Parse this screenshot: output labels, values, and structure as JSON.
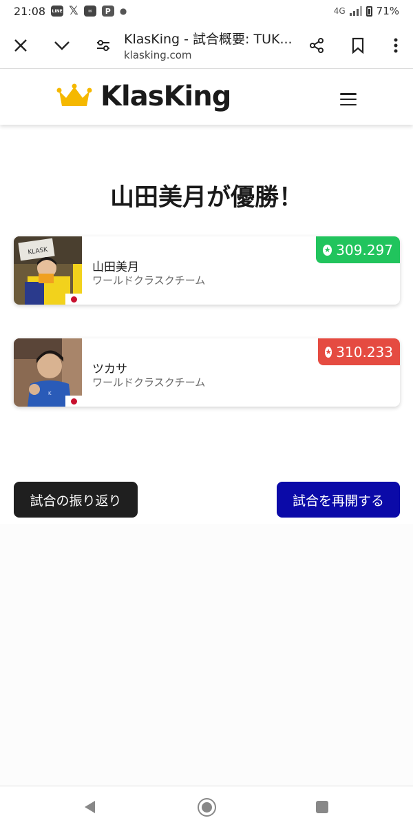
{
  "status_bar": {
    "time": "21:08",
    "app_icons": [
      "LINE",
      "X",
      "mail",
      "PayPay"
    ],
    "network": "4G",
    "battery": "71%"
  },
  "browser": {
    "page_title": "KlasKing - 試合概要: TUK...",
    "domain": "klasking.com",
    "icons": [
      "close-icon",
      "chevron-down-icon",
      "site-settings-icon",
      "share-icon",
      "bookmark-icon",
      "more-vert-icon"
    ]
  },
  "site": {
    "logo_text": "KlasKing",
    "colors": {
      "crown": "#f5b800"
    }
  },
  "match": {
    "headline": "山田美月が優勝！",
    "players": [
      {
        "name": "山田美月",
        "team": "ワールドクラスクチーム",
        "score": "309.297",
        "badge_color": "#21c45d"
      },
      {
        "name": "ツカサ",
        "team": "ワールドクラスクチーム",
        "score": "310.233",
        "badge_color": "#e54b41"
      }
    ]
  },
  "actions": {
    "review_label": "試合の振り返り",
    "resume_label": "試合を再開する"
  }
}
